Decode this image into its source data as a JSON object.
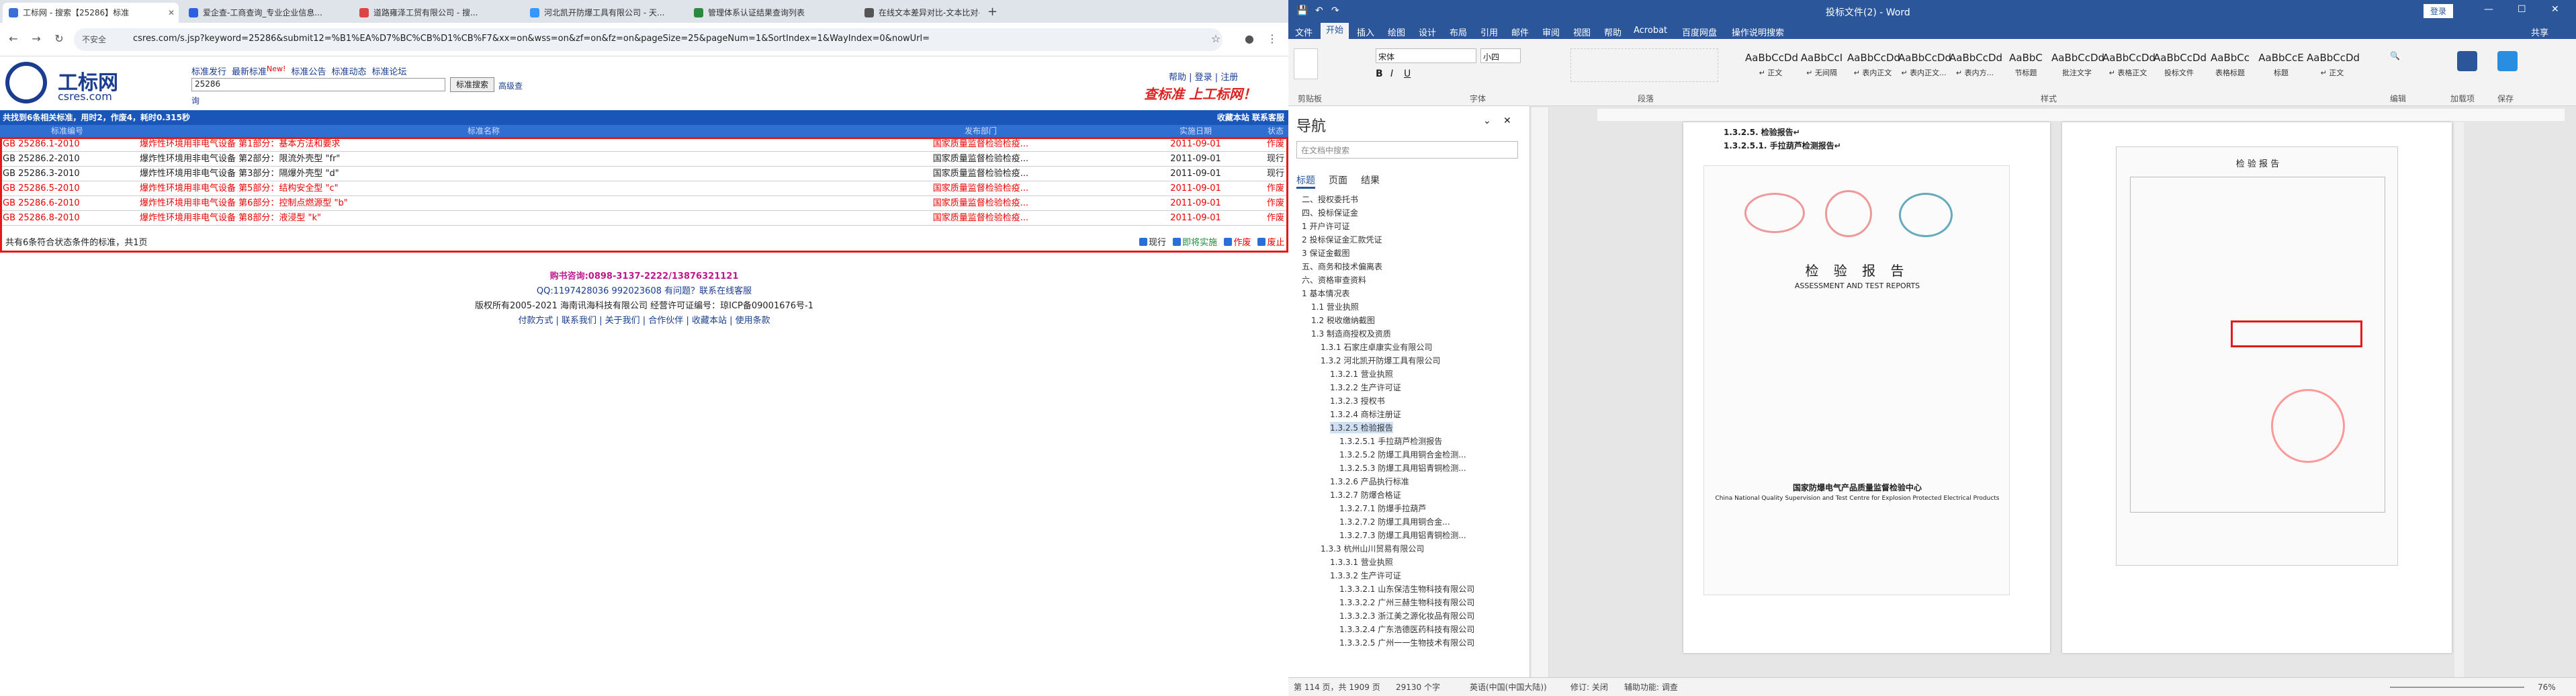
{
  "browser": {
    "tabs": [
      {
        "label": "工标网 - 搜索【25286】标准"
      },
      {
        "label": "爱企查-工商查询_专业企业信息..."
      },
      {
        "label": "道路雍泽工贸有限公司 - 搜..."
      },
      {
        "label": "河北凯开防爆工具有限公司 - 天..."
      },
      {
        "label": "管理体系认证结果查询列表"
      },
      {
        "label": "在线文本差异对比-文本比对-文..."
      }
    ],
    "security_label": "不安全",
    "url": "csres.com/s.jsp?keyword=25286&submit12=%B1%EA%D7%BC%CB%D1%CB%F7&xx=on&wss=on&zf=on&fz=on&pageSize=25&pageNum=1&SortIndex=1&WayIndex=0&nowUrl="
  },
  "site": {
    "logo_text": "工标网",
    "logo_sub": "csres.com",
    "top_links": [
      "标准发行",
      "最新标准",
      "New!",
      "标准公告",
      "标准动态",
      "标准论坛"
    ],
    "search_value": "25286",
    "search_button": "标准搜索",
    "advanced_link": "高级查",
    "query_link": "询",
    "right_links": "帮助 | 登录 | 注册",
    "slogan": "查标准 上工标网！",
    "result_bar_left": "共找到6条相关标准，用时2，作废4，耗时0.315秒",
    "result_bar_right": "收藏本站  联系客服",
    "table_headers": [
      "标准编号",
      "标准名称",
      "发布部门",
      "实施日期",
      "状态"
    ],
    "rows": [
      {
        "code": "GB 25286.1-2010",
        "name": "爆炸性环境用非电气设备 第1部分：基本方法和要求",
        "dept": "国家质量监督检验检疫...",
        "date": "2011-09-01",
        "status": "作废",
        "red": true
      },
      {
        "code": "GB 25286.2-2010",
        "name": "爆炸性环境用非电气设备 第2部分：限流外壳型 \"fr\"",
        "dept": "国家质量监督检验检疫...",
        "date": "2011-09-01",
        "status": "现行",
        "red": false
      },
      {
        "code": "GB 25286.3-2010",
        "name": "爆炸性环境用非电气设备 第3部分：隔爆外壳型 \"d\"",
        "dept": "国家质量监督检验检疫...",
        "date": "2011-09-01",
        "status": "现行",
        "red": false
      },
      {
        "code": "GB 25286.5-2010",
        "name": "爆炸性环境用非电气设备 第5部分：结构安全型 \"c\"",
        "dept": "国家质量监督检验检疫...",
        "date": "2011-09-01",
        "status": "作废",
        "red": true
      },
      {
        "code": "GB 25286.6-2010",
        "name": "爆炸性环境用非电气设备 第6部分：控制点燃源型 \"b\"",
        "dept": "国家质量监督检验检疫...",
        "date": "2011-09-01",
        "status": "作废",
        "red": true
      },
      {
        "code": "GB 25286.8-2010",
        "name": "爆炸性环境用非电气设备 第8部分：液浸型 \"k\"",
        "dept": "国家质量监督检验检疫...",
        "date": "2011-09-01",
        "status": "作废",
        "red": true
      }
    ],
    "summary": "共有6条符合状态条件的标准，共1页",
    "legend": [
      "现行",
      "即将实施",
      "作废",
      "废止"
    ],
    "footer_phone": "购书咨询:0898-3137-2222/13876321121",
    "footer_qq": "QQ:1197428036 992023608 有问题？联系在线客服",
    "footer_copyright": "版权所有2005-2021 海南讯海科技有限公司 经营许可证编号：琼ICP备09001676号-1",
    "footer_links": "付款方式 | 联系我们 | 关于我们 | 合作伙伴 | 收藏本站 | 使用条款"
  },
  "word": {
    "title": "投标文件(2) - Word",
    "user_button": "登录",
    "tabs": [
      "文件",
      "开始",
      "插入",
      "绘图",
      "设计",
      "布局",
      "引用",
      "邮件",
      "审阅",
      "视图",
      "帮助",
      "Acrobat",
      "百度网盘",
      "操作说明搜索"
    ],
    "share": "共享",
    "font_name": "宋体",
    "font_size": "小四",
    "groups": [
      "剪贴板",
      "字体",
      "段落",
      "样式",
      "编辑",
      "加载项",
      "保存"
    ],
    "styles": [
      {
        "preview": "AaBbCcDd",
        "name": "↵ 正文"
      },
      {
        "preview": "AaBbCcI",
        "name": "↵ 无间隔"
      },
      {
        "preview": "AaBbCcDd",
        "name": "↵ 表内正文"
      },
      {
        "preview": "AaBbCcDd",
        "name": "↵ 表内正文..."
      },
      {
        "preview": "AaBbCcDd",
        "name": "↵ 表内方..."
      },
      {
        "preview": "AaBbC",
        "name": "节标题"
      },
      {
        "preview": "AaBbCcDd",
        "name": "批注文字"
      },
      {
        "preview": "AaBbCcDd",
        "name": "↵ 表格正文"
      },
      {
        "preview": "AaBbCcDd",
        "name": "投标文件"
      },
      {
        "preview": "AaBbCc",
        "name": "表格标题"
      },
      {
        "preview": "AaBbCcE",
        "name": "标题"
      },
      {
        "preview": "AaBbCcDd",
        "name": "↵ 正文"
      }
    ],
    "nav_title": "导航",
    "nav_search": "在文档中搜索",
    "nav_tabs": [
      "标题",
      "页面",
      "结果"
    ],
    "nav_items": [
      "二、授权委托书",
      "四、投标保证金",
      "1 开户许可证",
      "2 投标保证金汇款凭证",
      "3 保证金截图",
      "五、商务和技术偏离表",
      "六、资格审查资料",
      "1 基本情况表",
      "1.1 营业执照",
      "1.2 税收缴纳截图",
      "1.3 制造商授权及资质",
      "1.3.1 石家庄卓康实业有限公司",
      "1.3.2 河北凯开防爆工具有限公司",
      "1.3.2.1 营业执照",
      "1.3.2.2 生产许可证",
      "1.3.2.3 授权书",
      "1.3.2.4 商标注册证",
      "1.3.2.5 检验报告",
      "1.3.2.5.1 手拉葫芦检测报告",
      "1.3.2.5.2 防爆工具用铜合金检测...",
      "1.3.2.5.3 防爆工具用铝青铜检测...",
      "1.3.2.6 产品执行标准",
      "1.3.2.7 防爆合格证",
      "1.3.2.7.1 防爆手拉葫芦",
      "1.3.2.7.2 防爆工具用铜合金...",
      "1.3.2.7.3 防爆工具用铝青铜检测...",
      "1.3.3 杭州山川贸易有限公司",
      "1.3.3.1 营业执照",
      "1.3.3.2 生产许可证",
      "1.3.3.2.1 山东保洁生物科技有限公司",
      "1.3.3.2.2 广州三赫生物科技有限公司",
      "1.3.3.2.3 浙江美之源化妆品有限公司",
      "1.3.3.2.4 广东浩德医药科技有限公司",
      "1.3.3.2.5 广州一一生物技术有限公司"
    ],
    "doc_heading1": "1.3.2.5. 检验报告↵",
    "doc_heading2": "1.3.2.5.1. 手拉葫芦检测报告↵",
    "report_title": "检 验 报 告",
    "report_subtitle": "ASSESSMENT AND TEST REPORTS",
    "report_center": "国家防爆电气产品质量监督检验中心",
    "report_center_en": "China National Quality Supervision and Test Centre for Explosion Protected Electrical Products",
    "right_page_title": "检 验 报 告",
    "status_page": "第 114 页，共 1909 页",
    "status_words": "29130 个字",
    "status_lang": "英语(中国(中国大陆))",
    "status_rev": "修订: 关闭",
    "status_assist": "辅助功能: 调查",
    "status_zoom": "76%"
  }
}
